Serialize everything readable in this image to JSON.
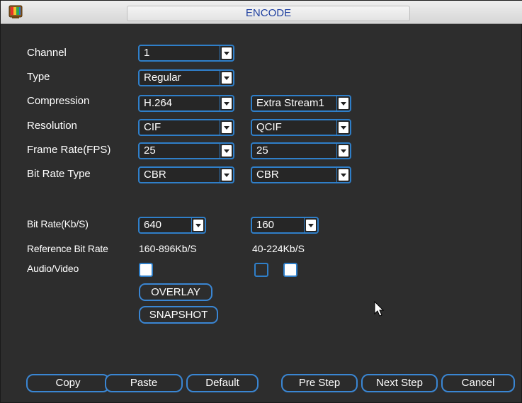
{
  "window": {
    "title": "ENCODE",
    "icon": "app-icon"
  },
  "form": {
    "channel": {
      "label": "Channel",
      "value": "1"
    },
    "type": {
      "label": "Type",
      "value": "Regular"
    },
    "compression": {
      "label": "Compression",
      "main": "H.264",
      "extra": "Extra Stream1"
    },
    "resolution": {
      "label": "Resolution",
      "main": "CIF",
      "extra": "QCIF"
    },
    "frame_rate": {
      "label": "Frame Rate(FPS)",
      "main": "25",
      "extra": "25"
    },
    "bit_rate_type": {
      "label": "Bit Rate Type",
      "main": "CBR",
      "extra": "CBR"
    },
    "bit_rate": {
      "label": "Bit Rate(Kb/S)",
      "main": "640",
      "extra": "160"
    },
    "reference_bit_rate": {
      "label": "Reference Bit Rate",
      "main": "160-896Kb/S",
      "extra": "40-224Kb/S"
    },
    "audio_video": {
      "label": "Audio/Video",
      "main_checked": true,
      "extra_audio_checked": false,
      "extra_video_checked": true
    }
  },
  "buttons": {
    "overlay": "OVERLAY",
    "snapshot": "SNAPSHOT",
    "copy": "Copy",
    "paste": "Paste",
    "default": "Default",
    "pre_step": "Pre Step",
    "next_step": "Next Step",
    "cancel": "Cancel"
  },
  "colors": {
    "accent": "#2f7fc9",
    "title_text": "#1e3fa0",
    "background": "#2d2d2d"
  }
}
